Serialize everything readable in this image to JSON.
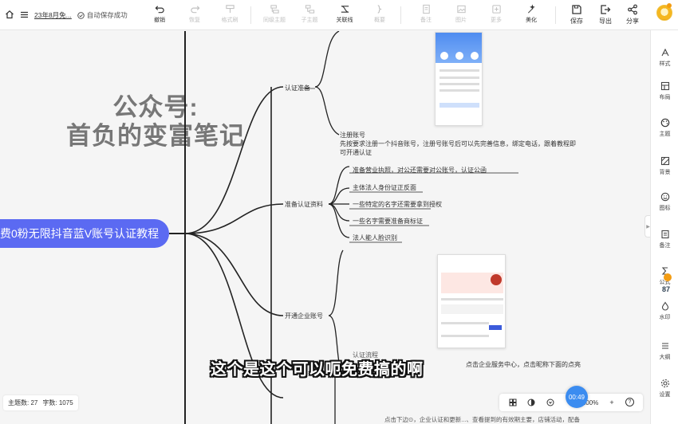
{
  "toolbar": {
    "doc_title": "23年8月免...",
    "save_status": "自动保存成功",
    "buttons": {
      "undo": "撤销",
      "redo": "恢复",
      "format_painter": "格式刷",
      "sibling_topic": "同级主题",
      "child_topic": "子主题",
      "relation_line": "关联线",
      "summary": "概要",
      "note": "备注",
      "image": "图片",
      "more": "更多",
      "beautify": "美化",
      "save": "保存",
      "export": "导出",
      "share": "分享"
    }
  },
  "right_panel": {
    "style": "样式",
    "layout": "布局",
    "theme": "主题",
    "background": "背景",
    "icon": "图标",
    "remark": "备注",
    "formula": "公式",
    "formula_badge": "87",
    "watermark": "水印",
    "outline": "大纲",
    "settings": "设置"
  },
  "canvas": {
    "watermark_line1": "公众号:",
    "watermark_line2": "首负的变富笔记",
    "root_node": "费0粉无限抖音蓝V账号认证教程",
    "branches": {
      "auth_prep": "认证准备",
      "prep_materials": "准备认证资料",
      "open_enterprise": "开通企业账号",
      "auth_flow": "认证流程"
    },
    "register_note": {
      "title": "注册账号",
      "body": "先按要求注册一个抖音账号，注册号账号后可以先完善信息，绑定电话，跟着教程即可开通认证"
    },
    "materials": [
      "准备营业执照，对公还需要对公账号，认证公函",
      "主体法人身份证正反面",
      "一些特定的名字还需要拿到授权",
      "一些名字需要准备商标证",
      "法人能人脸识别"
    ],
    "enterprise_note": "点击企业服务中心，点击昵称下面的点亮",
    "bottom_note": "点击下边⊙，企业认证和更新...、查看提到的有效期主要，店铺活动，配备"
  },
  "subtitle": "这个是这个可以呃免费搞的啊",
  "status_bar": {
    "topic_count_label": "主题数:",
    "topic_count": "27",
    "word_count_label": "字数:",
    "word_count": "1075"
  },
  "zoom": {
    "level": "100%",
    "timer": "00:49",
    "zoom_in": "+",
    "help": "?"
  }
}
